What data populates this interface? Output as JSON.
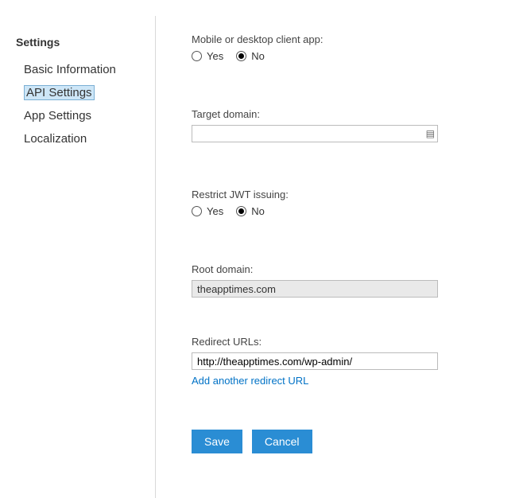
{
  "sidebar": {
    "heading": "Settings",
    "items": [
      {
        "label": "Basic Information",
        "selected": false
      },
      {
        "label": "API Settings",
        "selected": true
      },
      {
        "label": "App Settings",
        "selected": false
      },
      {
        "label": "Localization",
        "selected": false
      }
    ]
  },
  "form": {
    "client_app": {
      "label": "Mobile or desktop client app:",
      "yes": "Yes",
      "no": "No",
      "value": "No"
    },
    "target_domain": {
      "label": "Target domain:",
      "value": ""
    },
    "restrict_jwt": {
      "label": "Restrict JWT issuing:",
      "yes": "Yes",
      "no": "No",
      "value": "No"
    },
    "root_domain": {
      "label": "Root domain:",
      "value": "theapptimes.com"
    },
    "redirect_urls": {
      "label": "Redirect URLs:",
      "value": "http://theapptimes.com/wp-admin/",
      "add_link": "Add another redirect URL"
    },
    "buttons": {
      "save": "Save",
      "cancel": "Cancel"
    }
  }
}
